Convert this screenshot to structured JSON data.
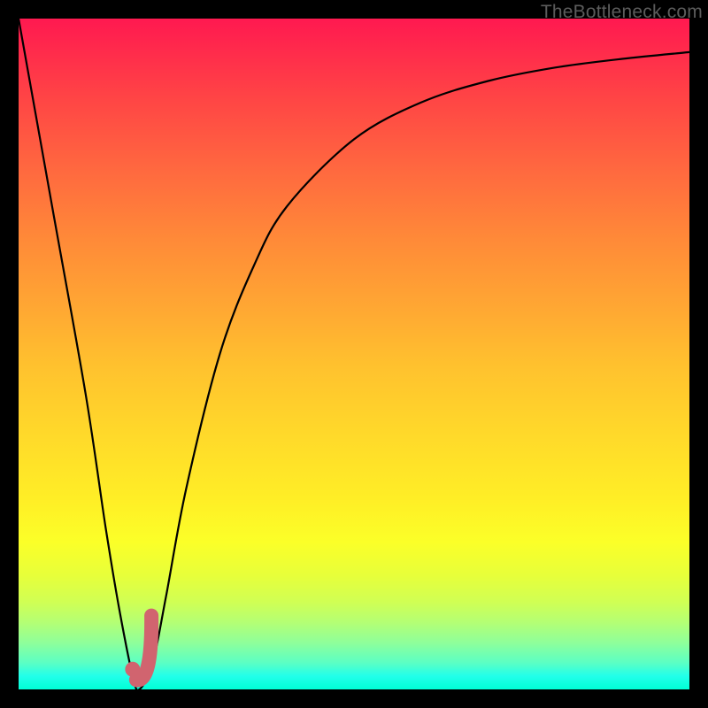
{
  "watermark": "TheBottleneck.com",
  "colors": {
    "frame": "#000000",
    "curve": "#000000",
    "marker_stroke": "#d1646f",
    "marker_fill": "#d1646f"
  },
  "chart_data": {
    "type": "line",
    "title": "",
    "xlabel": "",
    "ylabel": "",
    "xlim": [
      0,
      100
    ],
    "ylim": [
      0,
      100
    ],
    "grid": false,
    "series": [
      {
        "name": "bottleneck-curve",
        "x": [
          0,
          5,
          10,
          13,
          15,
          17,
          18,
          20,
          22,
          25,
          30,
          35,
          40,
          50,
          60,
          70,
          80,
          90,
          100
        ],
        "y": [
          100,
          72,
          44,
          24,
          12,
          2,
          0,
          4,
          14,
          30,
          50,
          63,
          72,
          82,
          87.5,
          90.7,
          92.7,
          94,
          95
        ]
      }
    ],
    "marker": {
      "name": "J-marker",
      "center": {
        "x": 17,
        "y": 3
      },
      "hook": {
        "x": 19.8,
        "y": 11
      }
    }
  }
}
